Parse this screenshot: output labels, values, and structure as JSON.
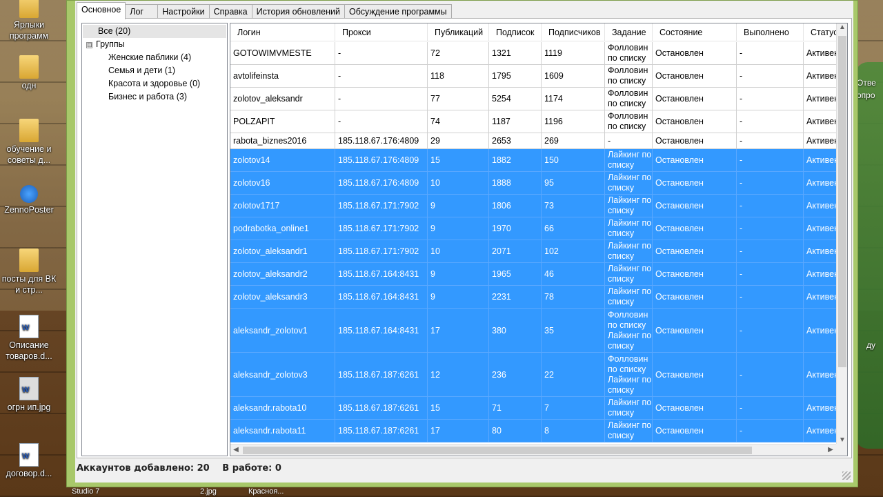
{
  "desktop": {
    "icons": [
      {
        "name": "shortcuts-folder",
        "label": "Ярлыки программ",
        "type": "folder"
      },
      {
        "name": "odn-folder",
        "label": "одн",
        "type": "folder"
      },
      {
        "name": "training-folder",
        "label": "обучение и советы д...",
        "type": "folder"
      },
      {
        "name": "zennoposter",
        "label": "ZennoPoster",
        "type": "app"
      },
      {
        "name": "vk-posts-folder",
        "label": "посты для ВК и стр...",
        "type": "folder"
      },
      {
        "name": "product-description-doc",
        "label": "Описание товаров.d...",
        "type": "doc"
      },
      {
        "name": "ogrn-image",
        "label": "огрн ип.jpg",
        "type": "image"
      },
      {
        "name": "contract-doc",
        "label": "договор.d...",
        "type": "doc"
      }
    ],
    "right_labels": [
      "Отве",
      "опро",
      "ду"
    ],
    "bottom_labels": [
      "Studio 7",
      "2.jpg",
      "Красноя..."
    ]
  },
  "tabs": [
    "Основное",
    "Лог",
    "Настройки",
    "Справка",
    "История обновлений",
    "Обсуждение программы"
  ],
  "active_tab": "Основное",
  "tree": {
    "all": "Все (20)",
    "group_toggle": "⊟",
    "group_label": "Группы",
    "children": [
      "Женские паблики (4)",
      "Семья и дети (1)",
      "Красота и здоровье (0)",
      "Бизнес и работа (3)"
    ]
  },
  "table": {
    "columns": [
      "Логин",
      "Прокси",
      "Публикаций",
      "Подписок",
      "Подписчиков",
      "Задание",
      "Состояние",
      "Выполнено",
      "Статус"
    ],
    "rows": [
      {
        "login": "GOTOWIMVMESTE",
        "proxy": "-",
        "posts": "72",
        "following": "1321",
        "followers": "1119",
        "task": "Фолловин по списку",
        "state": "Остановлен",
        "done": "-",
        "status": "Активен",
        "selected": false
      },
      {
        "login": "avtolifeinsta",
        "proxy": "-",
        "posts": "118",
        "following": "1795",
        "followers": "1609",
        "task": "Фолловин по списку",
        "state": "Остановлен",
        "done": "-",
        "status": "Активен",
        "selected": false
      },
      {
        "login": "zolotov_aleksandr",
        "proxy": "-",
        "posts": "77",
        "following": "5254",
        "followers": "1174",
        "task": "Фолловин по списку",
        "state": "Остановлен",
        "done": "-",
        "status": "Активен",
        "selected": false
      },
      {
        "login": "POLZAPIT",
        "proxy": "-",
        "posts": "74",
        "following": "1187",
        "followers": "1196",
        "task": "Фолловин по списку",
        "state": "Остановлен",
        "done": "-",
        "status": "Активен",
        "selected": false
      },
      {
        "login": "rabota_biznes2016",
        "proxy": "185.118.67.176:4809",
        "posts": "29",
        "following": "2653",
        "followers": "269",
        "task": "-",
        "state": "Остановлен",
        "done": "-",
        "status": "Активен",
        "selected": false
      },
      {
        "login": "zolotov14",
        "proxy": "185.118.67.176:4809",
        "posts": "15",
        "following": "1882",
        "followers": "150",
        "task": "Лайкинг по списку",
        "state": "Остановлен",
        "done": "-",
        "status": "Активен",
        "selected": true
      },
      {
        "login": "zolotov16",
        "proxy": "185.118.67.176:4809",
        "posts": "10",
        "following": "1888",
        "followers": "95",
        "task": "Лайкинг по списку",
        "state": "Остановлен",
        "done": "-",
        "status": "Активен",
        "selected": true
      },
      {
        "login": "zolotov1717",
        "proxy": "185.118.67.171:7902",
        "posts": "9",
        "following": "1806",
        "followers": "73",
        "task": "Лайкинг по списку",
        "state": "Остановлен",
        "done": "-",
        "status": "Активен",
        "selected": true
      },
      {
        "login": "podrabotka_online1",
        "proxy": "185.118.67.171:7902",
        "posts": "9",
        "following": "1970",
        "followers": "66",
        "task": "Лайкинг по списку",
        "state": "Остановлен",
        "done": "-",
        "status": "Активен",
        "selected": true
      },
      {
        "login": "zolotov_aleksandr1",
        "proxy": "185.118.67.171:7902",
        "posts": "10",
        "following": "2071",
        "followers": "102",
        "task": "Лайкинг по списку",
        "state": "Остановлен",
        "done": "-",
        "status": "Активен",
        "selected": true
      },
      {
        "login": "zolotov_aleksandr2",
        "proxy": "185.118.67.164:8431",
        "posts": "9",
        "following": "1965",
        "followers": "46",
        "task": "Лайкинг по списку",
        "state": "Остановлен",
        "done": "-",
        "status": "Активен",
        "selected": true
      },
      {
        "login": "zolotov_aleksandr3",
        "proxy": "185.118.67.164:8431",
        "posts": "9",
        "following": "2231",
        "followers": "78",
        "task": "Лайкинг по списку",
        "state": "Остановлен",
        "done": "-",
        "status": "Активен",
        "selected": true
      },
      {
        "login": "aleksandr_zolotov1",
        "proxy": "185.118.67.164:8431",
        "posts": "17",
        "following": "380",
        "followers": "35",
        "task": "Фолловин по списку Лайкинг по списку",
        "state": "Остановлен",
        "done": "-",
        "status": "Активен",
        "selected": true
      },
      {
        "login": "aleksandr_zolotov3",
        "proxy": "185.118.67.187:6261",
        "posts": "12",
        "following": "236",
        "followers": "22",
        "task": "Фолловин по списку Лайкинг по списку",
        "state": "Остановлен",
        "done": "-",
        "status": "Активен",
        "selected": true
      },
      {
        "login": "aleksandr.rabota10",
        "proxy": "185.118.67.187:6261",
        "posts": "15",
        "following": "71",
        "followers": "7",
        "task": "Лайкинг по списку",
        "state": "Остановлен",
        "done": "-",
        "status": "Активен",
        "selected": true
      },
      {
        "login": "aleksandr.rabota11",
        "proxy": "185.118.67.187:6261",
        "posts": "17",
        "following": "80",
        "followers": "8",
        "task": "Лайкинг по списку",
        "state": "Остановлен",
        "done": "-",
        "status": "Активен",
        "selected": true
      }
    ]
  },
  "scroll_icons": {
    "up": "▲",
    "down": "▼",
    "left": "◀",
    "right": "▶"
  },
  "status": {
    "accounts_added": "Аккаунтов добавлено: 20",
    "in_work": "В работе: 0"
  },
  "colors": {
    "selection": "#3399ff",
    "window_frame": "#a8c86a"
  }
}
